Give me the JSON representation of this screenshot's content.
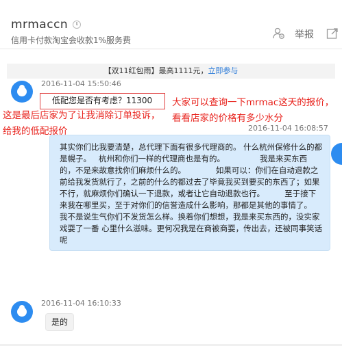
{
  "header": {
    "title": "mrmaccn",
    "subtitle": "信用卡付款淘宝会收款1%服务费",
    "report_label": "举报"
  },
  "banner": {
    "text": "【双11红包雨】最高1111元，",
    "link": "立即参与"
  },
  "messages": {
    "m1": {
      "timestamp": "2016-11-04 15:50:46",
      "text": "低配您是否有考虑？11300"
    },
    "m2": {
      "timestamp": "2016-11-04 16:08:57",
      "text": "其实你们比我要清楚，总代理下面有很多代理商的。 什么杭州保修什么的都是幌子。   杭州和你们一样的代理商也是有的。              我是来买东西的，不是来故意找你们麻烦什么的。            如果可以：你们在自动退款之前给我发货就行了，之前的什么的都过去了毕竟我买到要买的东西了；如果不行，就麻烦你们确认一下退款，或者让它自动退款也行。        至于接下来我在哪里买，至于对你们的信誉造成什么影响，那都是其他的事情了。              我不是说生气你们不发货怎么样。换着你们想想，我是来买东西的，没实家戏耍了一番 心里什么滋味。更何况我是在商被商耍，传出去，还被同事笑话呢"
    },
    "m3": {
      "timestamp": "2016-11-04 16:10:33",
      "text": "是的"
    }
  },
  "annotations": {
    "left": "这是最后店家为了让我消除订单投诉，给我的低配报价",
    "right": "大家可以查询一下mrmac这天的报价，看看店家的价格有多少水分"
  },
  "colors": {
    "annotation": "#e8231d",
    "link": "#2a7ad8",
    "avatar": "#2d8cf0",
    "right_bubble": "#d8ebfc"
  }
}
